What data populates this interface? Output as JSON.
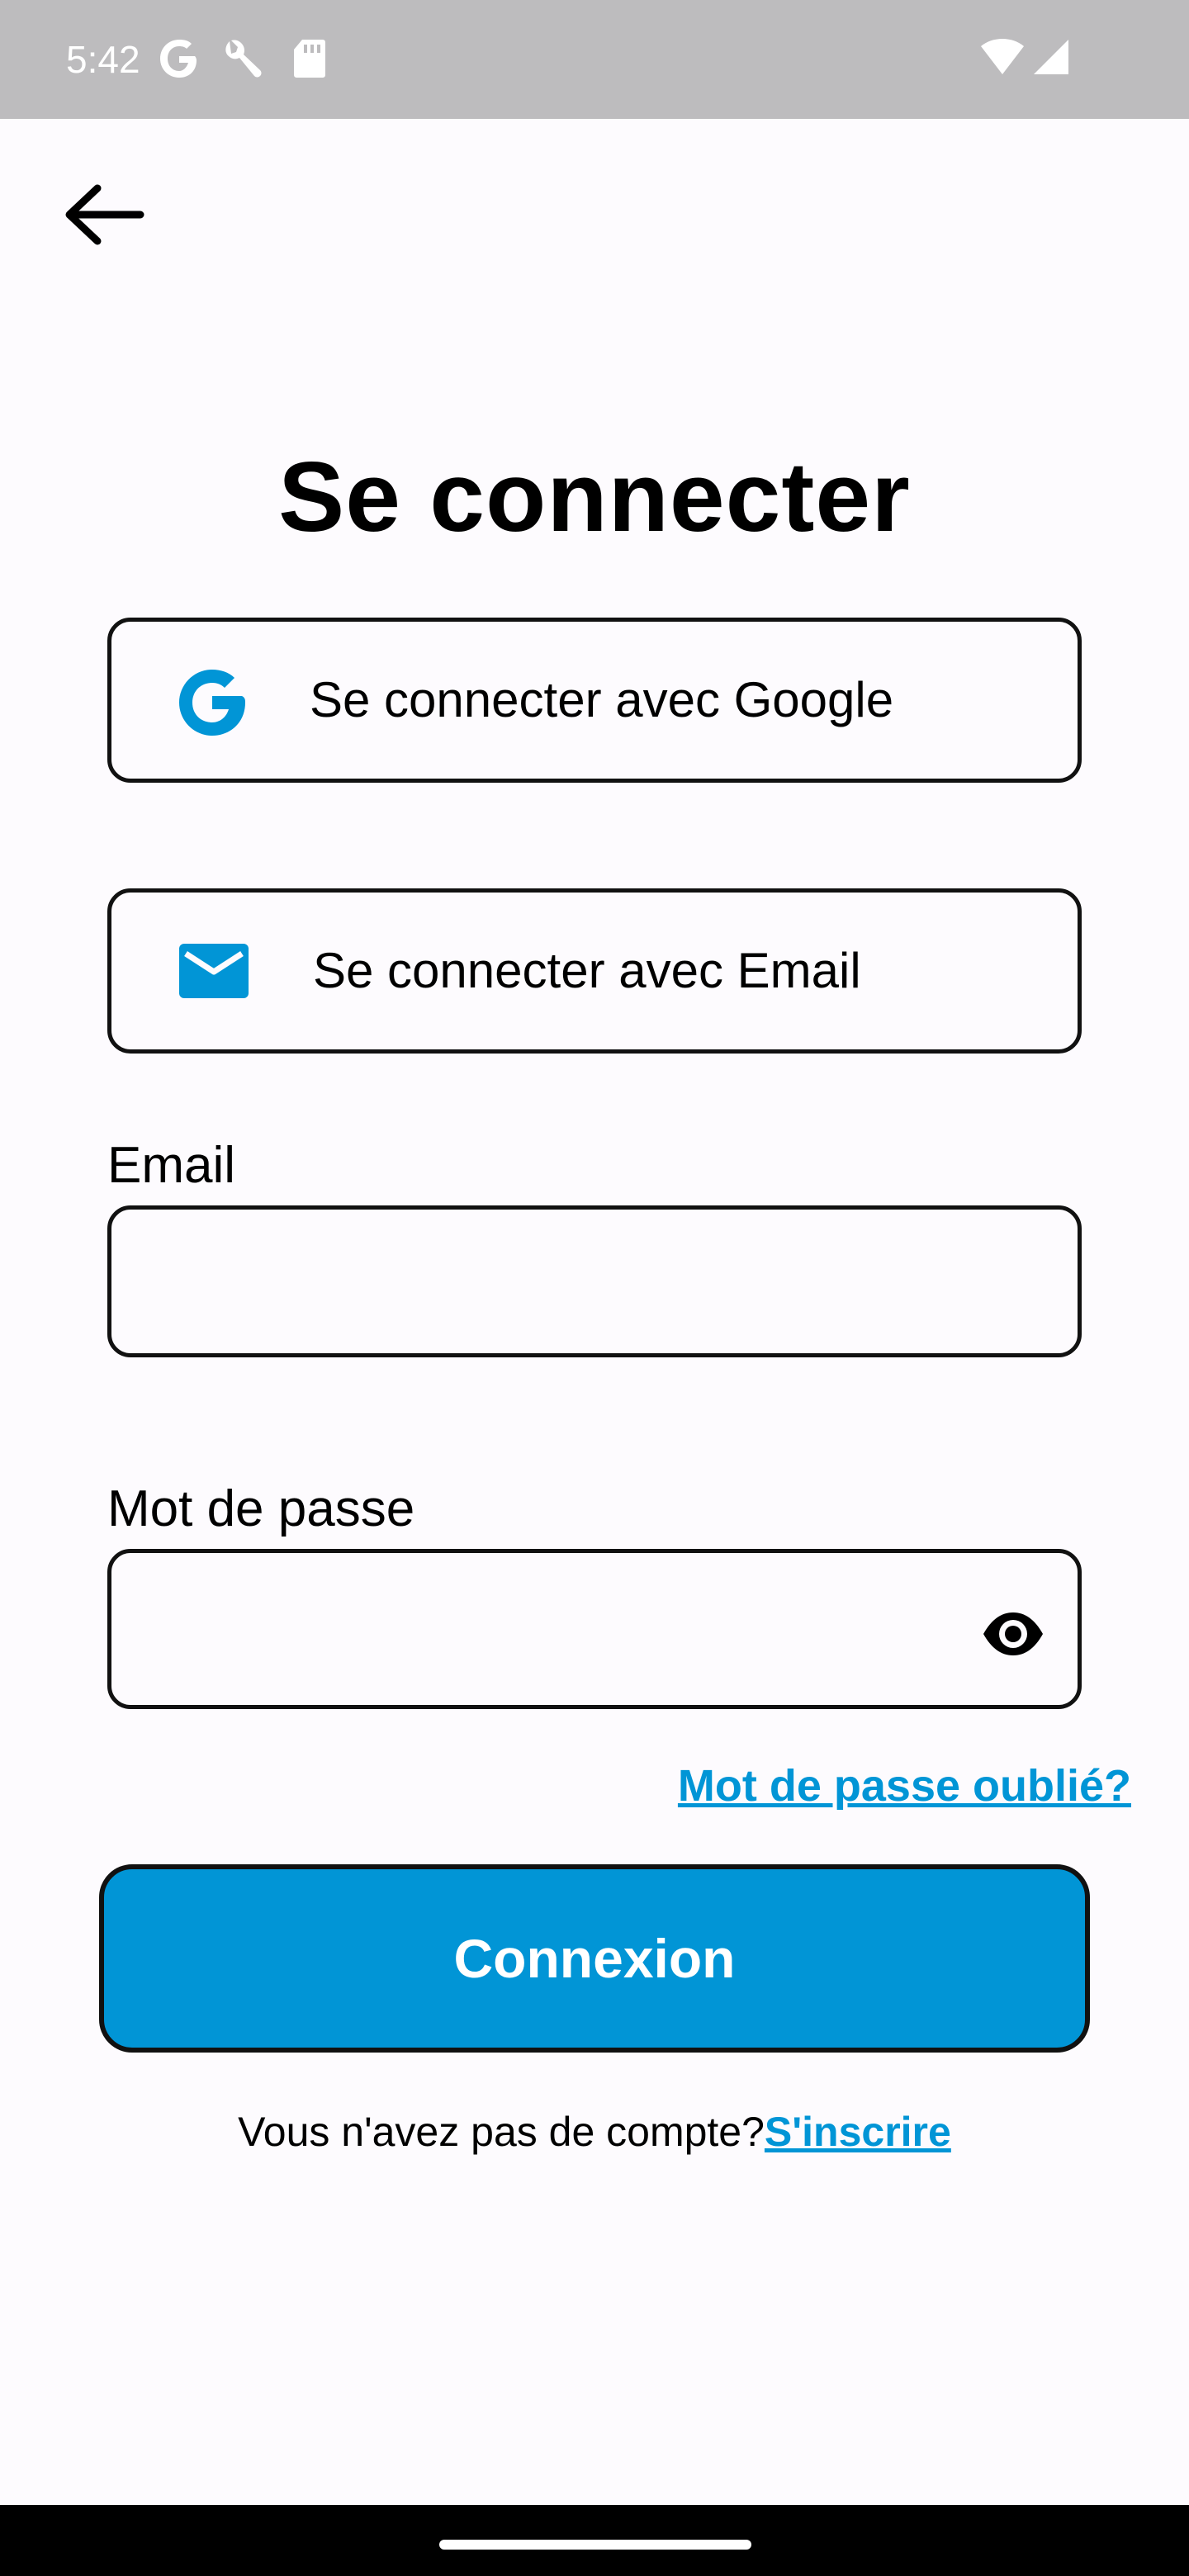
{
  "status_bar": {
    "time": "5:42",
    "icons": [
      "google-icon",
      "wrench-icon",
      "sd-card-icon",
      "wifi-icon",
      "cellular-signal-icon"
    ]
  },
  "header": {
    "back_icon": "arrow-left-icon"
  },
  "page": {
    "title": "Se connecter"
  },
  "social_buttons": {
    "google_label": "Se connecter avec Google",
    "google_icon": "google-g-icon",
    "email_label": "Se connecter avec Email",
    "email_icon": "envelope-icon"
  },
  "form": {
    "email_label": "Email",
    "email_value": "",
    "password_label": "Mot de passe",
    "password_value": "",
    "password_toggle_icon": "eye-icon",
    "forgot_password": "Mot de passe oublié?",
    "submit_label": "Connexion"
  },
  "signup": {
    "prompt": "Vous n'avez pas de compte?",
    "link": "S'inscrire"
  },
  "colors": {
    "accent": "#0195d6",
    "background": "#fdfbfe",
    "status_bar": "#bdbcbe",
    "border": "#111111"
  }
}
